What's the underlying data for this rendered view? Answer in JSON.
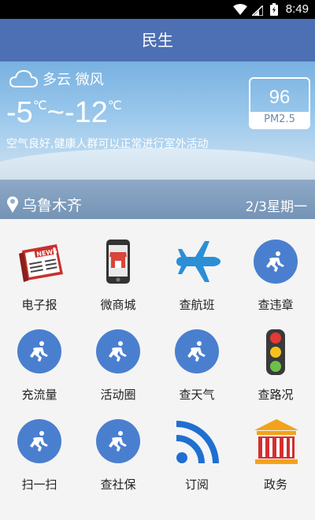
{
  "status": {
    "time": "8:49"
  },
  "header": {
    "title": "民生"
  },
  "weather": {
    "condition": "多云 微风",
    "temp_low": "-5",
    "temp_high": "-12",
    "temp_unit": "℃",
    "temp_sep": "~",
    "advice": "空气良好,健康人群可以正常进行室外活动",
    "pm_value": "96",
    "pm_label": "PM2.5",
    "city": "乌鲁木齐",
    "date": "2/3星期一"
  },
  "grid": [
    {
      "label": "电子报",
      "icon": "newspaper-icon"
    },
    {
      "label": "微商城",
      "icon": "phone-shop-icon"
    },
    {
      "label": "查航班",
      "icon": "airplane-icon"
    },
    {
      "label": "查违章",
      "icon": "runner-icon"
    },
    {
      "label": "充流量",
      "icon": "runner-icon"
    },
    {
      "label": "活动圈",
      "icon": "runner-icon"
    },
    {
      "label": "查天气",
      "icon": "runner-icon"
    },
    {
      "label": "查路况",
      "icon": "traffic-light-icon"
    },
    {
      "label": "扫一扫",
      "icon": "runner-icon"
    },
    {
      "label": "查社保",
      "icon": "runner-icon"
    },
    {
      "label": "订阅",
      "icon": "rss-icon"
    },
    {
      "label": "政务",
      "icon": "government-icon"
    }
  ],
  "colors": {
    "header": "#4d6fb3",
    "circle": "#4a7fd0"
  }
}
